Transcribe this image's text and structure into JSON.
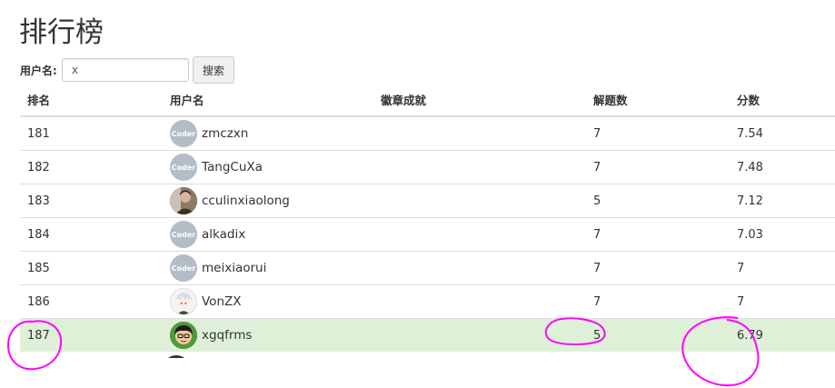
{
  "page": {
    "title": "排行榜"
  },
  "search": {
    "label": "用户名:",
    "value": "x",
    "button_label": "搜索"
  },
  "table": {
    "headers": {
      "rank": "排名",
      "username": "用户名",
      "badges": "徽章成就",
      "solved": "解题数",
      "score": "分数"
    },
    "rows": [
      {
        "rank": "181",
        "username": "zmczxn",
        "avatar": "coder-avatar",
        "badges": "",
        "solved": "7",
        "score": "7.54"
      },
      {
        "rank": "182",
        "username": "TangCuXa",
        "avatar": "coder-avatar",
        "badges": "",
        "solved": "7",
        "score": "7.48"
      },
      {
        "rank": "183",
        "username": "cculinxiaolong",
        "avatar": "photo-avatar",
        "badges": "",
        "solved": "5",
        "score": "7.12"
      },
      {
        "rank": "184",
        "username": "alkadix",
        "avatar": "coder-avatar",
        "badges": "",
        "solved": "7",
        "score": "7.03"
      },
      {
        "rank": "185",
        "username": "meixiaorui",
        "avatar": "coder-avatar",
        "badges": "",
        "solved": "7",
        "score": "7"
      },
      {
        "rank": "186",
        "username": "VonZX",
        "avatar": "anime-avatar",
        "badges": "",
        "solved": "7",
        "score": "7"
      },
      {
        "rank": "187",
        "username": "xgqfrms",
        "avatar": "cartoon-avatar",
        "badges": "",
        "solved": "5",
        "score": "6.79",
        "highlighted": true
      }
    ],
    "coder_avatar_text": "Coder"
  },
  "colors": {
    "highlight_row": "#dff0d8",
    "annotation": "#ff00ff",
    "coder_avatar_bg": "#b3bcc7"
  }
}
